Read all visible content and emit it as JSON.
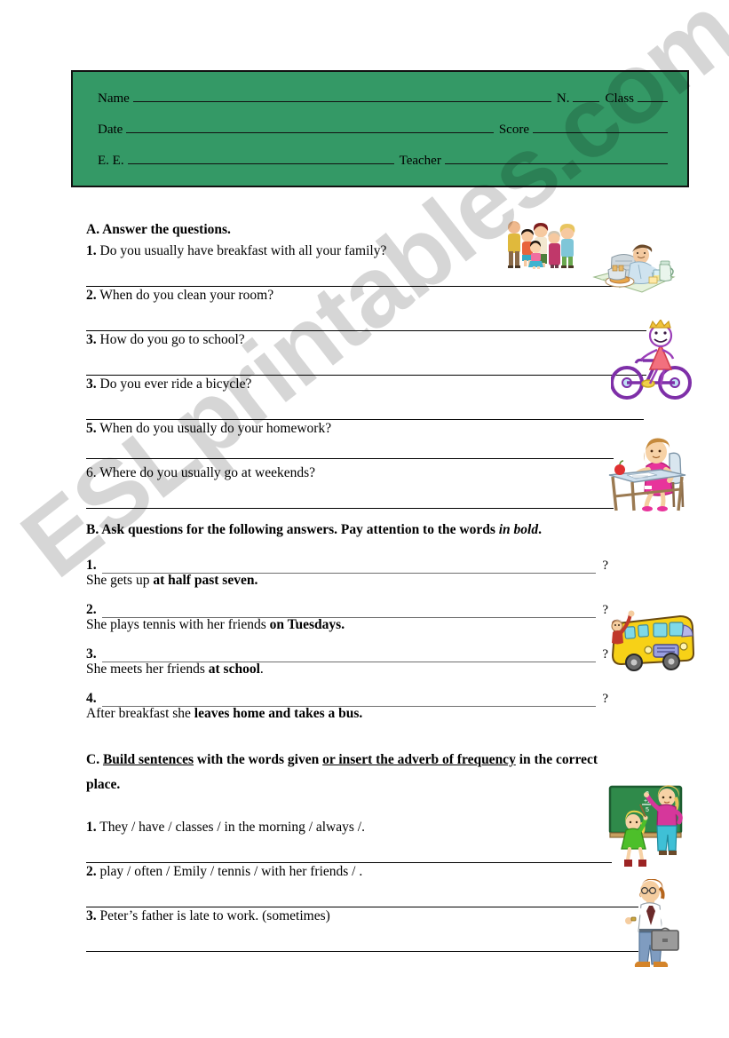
{
  "watermark": {
    "text": "ESLprintables.com"
  },
  "header": {
    "name_label": "Name",
    "n_label": "N.",
    "class_label": "Class",
    "date_label": "Date",
    "score_label": "Score",
    "ee_label": "E. E.",
    "teacher_label": "Teacher",
    "bg_color": "#349966",
    "border_color": "#111111"
  },
  "section_a": {
    "heading": "A. Answer the questions.",
    "questions": [
      {
        "num": "1.",
        "num_bold": true,
        "text": "Do you usually have breakfast with all your family?"
      },
      {
        "num": "2.",
        "num_bold": true,
        "text": "When do you clean your room?"
      },
      {
        "num": "3.",
        "num_bold": true,
        "text": "How do you go to school?"
      },
      {
        "num": "3.",
        "num_bold": true,
        "text": "Do you ever ride a bicycle?"
      },
      {
        "num": "5.",
        "num_bold": true,
        "text": "When do you usually do your homework?"
      },
      {
        "num": "6.",
        "num_bold": false,
        "text": "Where do you usually go at weekends?"
      }
    ]
  },
  "section_b": {
    "heading_pre": "B. Ask questions for the following answers. Pay attention to the words ",
    "heading_italic": "in bold",
    "heading_post": ".",
    "items": [
      {
        "num": "1.",
        "qmark": "?",
        "answer_pre": "She gets up ",
        "answer_bold": "at half past seven.",
        "answer_post": ""
      },
      {
        "num": "2.",
        "qmark": "?",
        "answer_pre": "She plays tennis with her friends ",
        "answer_bold": "on Tuesdays.",
        "answer_post": ""
      },
      {
        "num": "3.",
        "qmark": "?",
        "answer_pre": "She meets her friends ",
        "answer_bold": "at school",
        "answer_post": "."
      },
      {
        "num": "4.",
        "qmark": "?",
        "answer_pre": "After breakfast she ",
        "answer_bold": "leaves home and takes a bus.",
        "answer_post": ""
      }
    ]
  },
  "section_c": {
    "heading_p1": "C. ",
    "heading_u1": "Build sentences",
    "heading_p2": " with the words given ",
    "heading_u2": "or insert the adverb of frequency",
    "heading_p3": " in the correct",
    "heading_p4": "place.",
    "items": [
      {
        "num": "1.",
        "text": "They / have  / classes / in the morning / always /."
      },
      {
        "num": "2.",
        "text": "play / often / Emily / tennis / with her friends / ."
      },
      {
        "num": "3.",
        "text": "Peter’s father is late to work. (sometimes)"
      }
    ]
  },
  "clipart": [
    {
      "name": "family-group-illustration"
    },
    {
      "name": "man-having-breakfast-illustration"
    },
    {
      "name": "girl-riding-bicycle-illustration"
    },
    {
      "name": "girl-doing-homework-at-desk-illustration"
    },
    {
      "name": "yellow-school-bus-illustration"
    },
    {
      "name": "teacher-at-blackboard-illustration"
    },
    {
      "name": "man-with-briefcase-illustration"
    }
  ]
}
